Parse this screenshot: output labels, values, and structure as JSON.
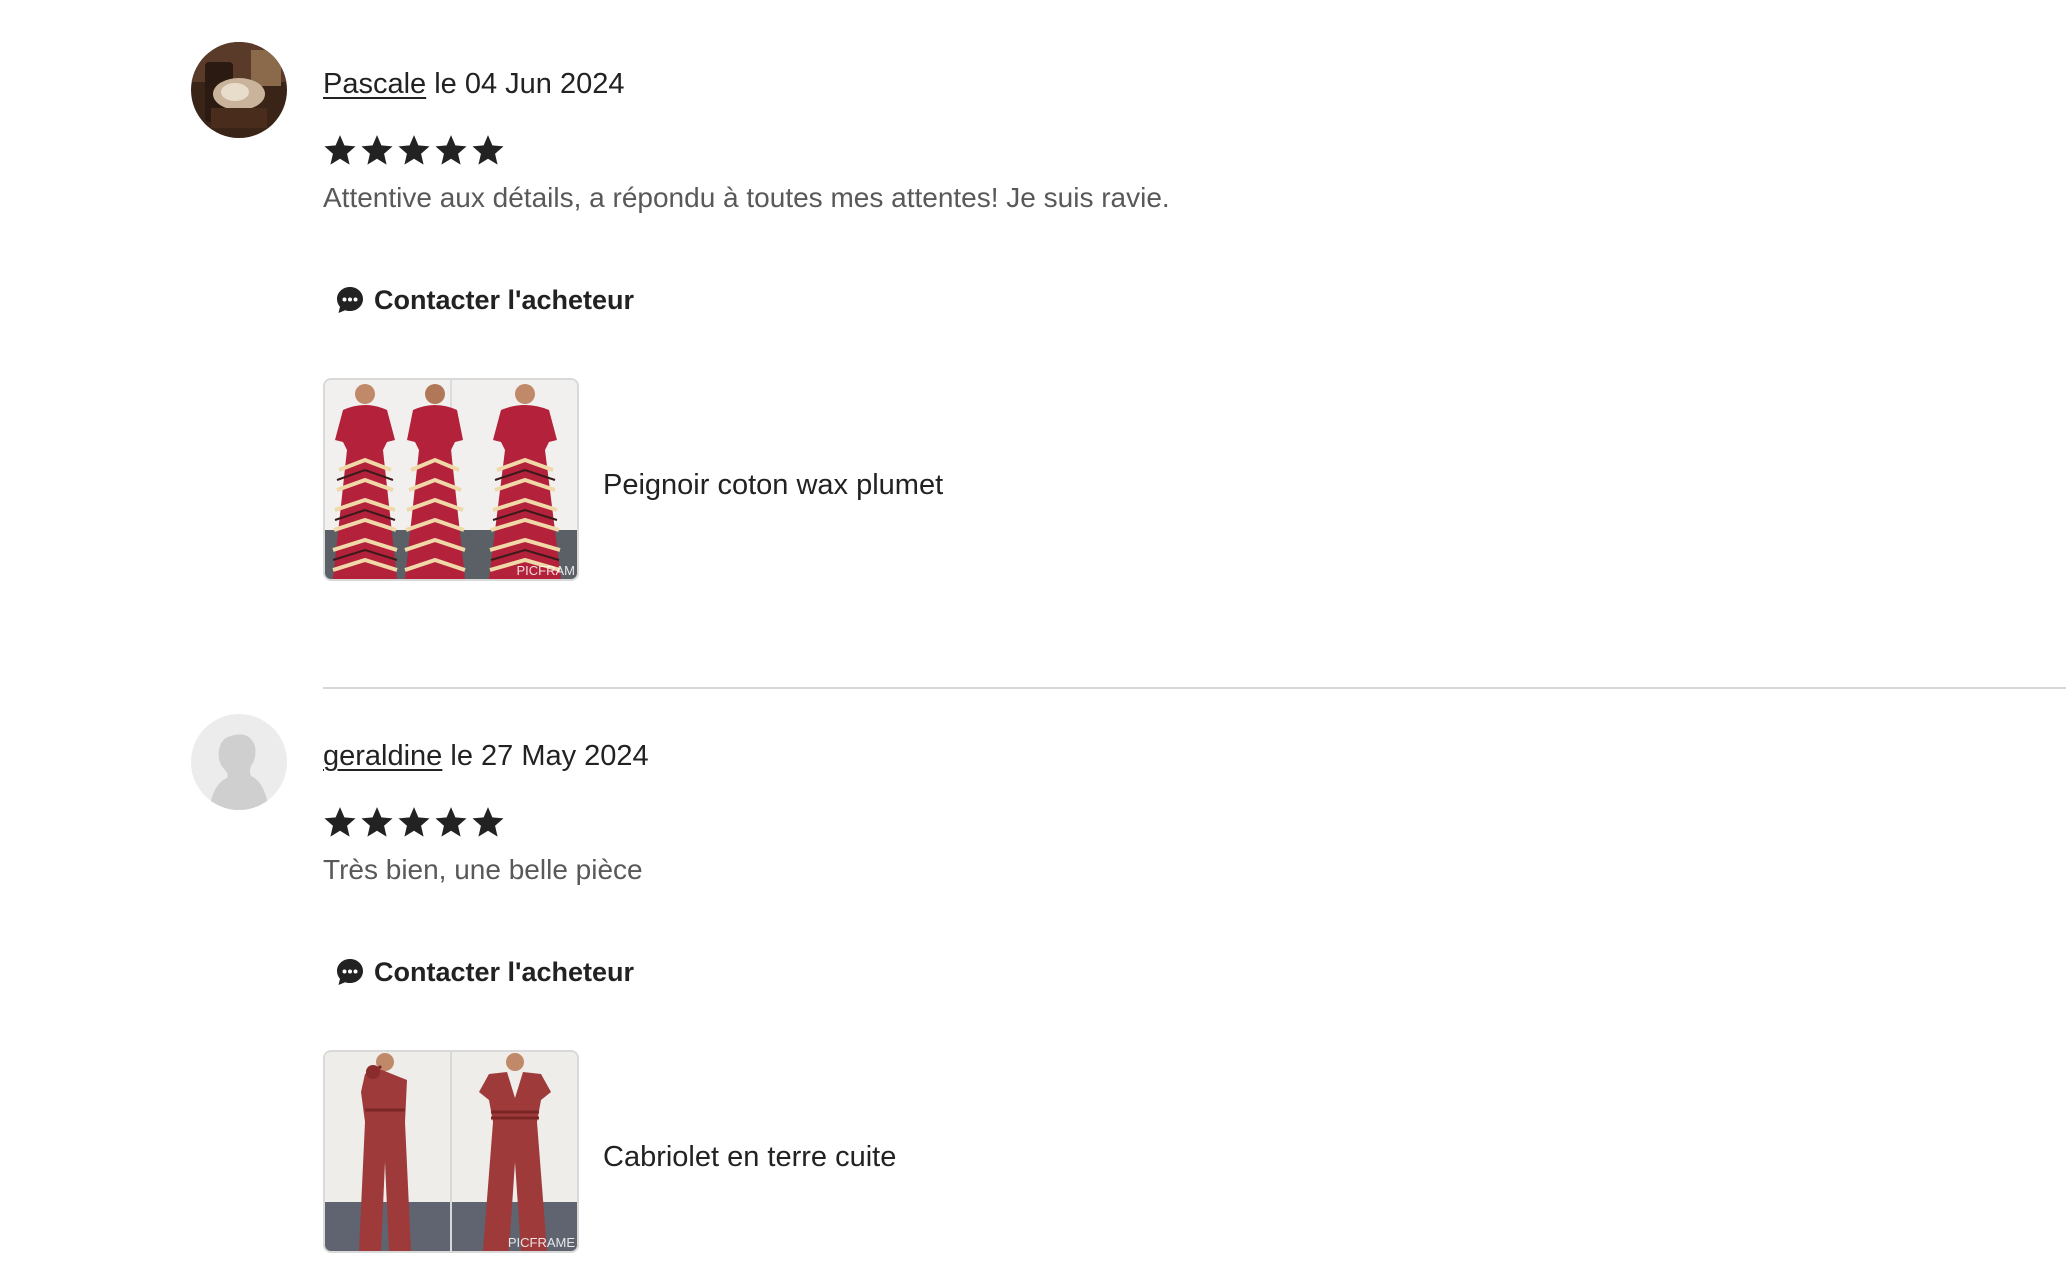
{
  "reviews": [
    {
      "reviewer_name": "Pascale",
      "date_text": "le 04 Jun 2024",
      "rating": 5,
      "comment": "Attentive aux détails, a répondu à toutes mes attentes! Je suis ravie.",
      "contact_label": "Contacter l'acheteur",
      "item_title": "Peignoir coton wax plumet",
      "thumb_watermark": "PICFRAM",
      "avatar_kind": "photo"
    },
    {
      "reviewer_name": "geraldine",
      "date_text": "le 27 May 2024",
      "rating": 5,
      "comment": "Très bien, une belle pièce",
      "contact_label": "Contacter l'acheteur",
      "item_title": "Cabriolet en terre cuite",
      "thumb_watermark": "PICFRAME",
      "avatar_kind": "default-silhouette"
    }
  ],
  "colors": {
    "text": "#222222",
    "comment_text": "#595959",
    "divider": "#d7d7d7",
    "star": "#222222",
    "dress_red": "#b3213a",
    "jumpsuit_red": "#9e3a3a"
  }
}
